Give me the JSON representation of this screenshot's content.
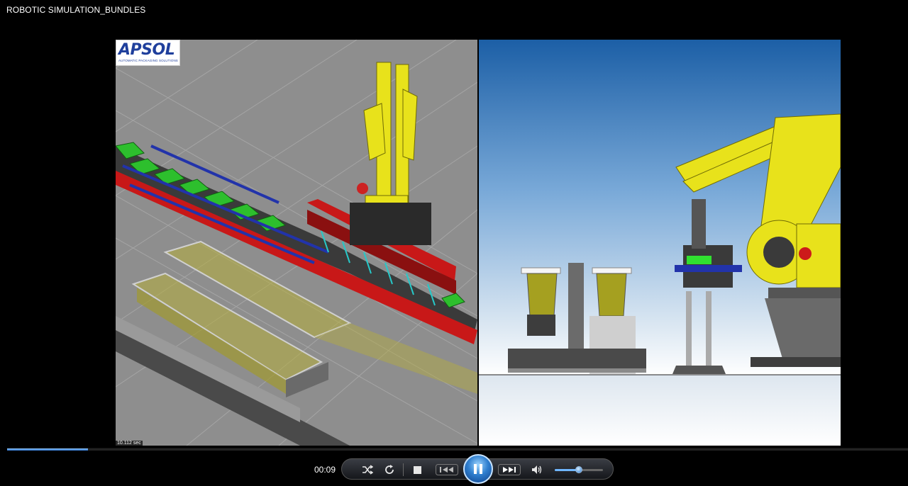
{
  "window": {
    "title": "ROBOTIC SIMULATION_BUNDLES"
  },
  "video": {
    "logo_text": "APSOL",
    "logo_subtitle": "AUTOMATIC PACKAGING SOLUTIONS",
    "sim_timer": "10.112 sec"
  },
  "player": {
    "current_time": "00:09",
    "progress_fraction": 0.09,
    "volume_fraction": 0.5,
    "state": "playing",
    "accent_color": "#2f7fcf"
  },
  "icons": {
    "shuffle": "shuffle-icon",
    "repeat": "repeat-icon",
    "stop": "stop-icon",
    "previous": "previous-icon",
    "pause": "pause-icon",
    "next": "next-icon",
    "volume": "volume-icon"
  }
}
